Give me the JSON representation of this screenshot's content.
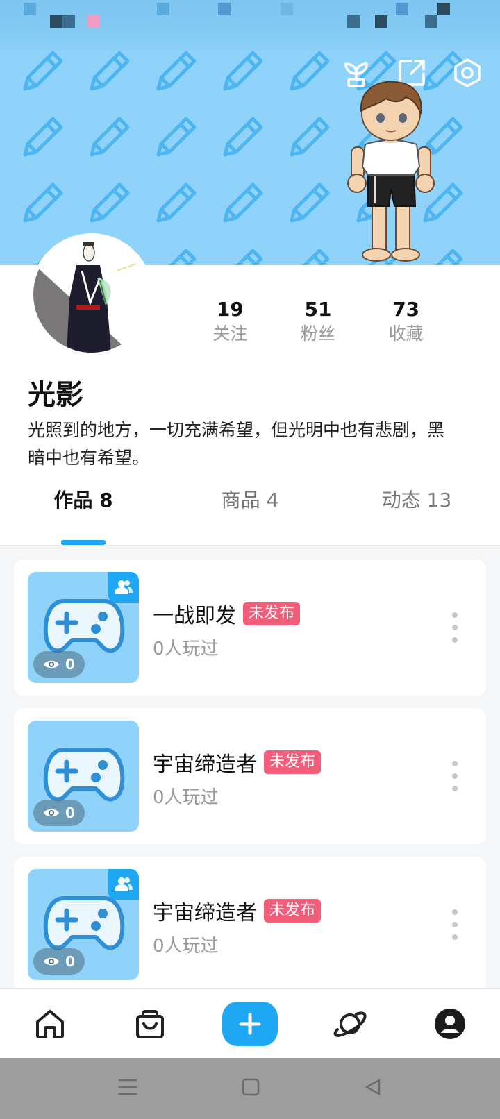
{
  "banner": {
    "icons": [
      "sprout-icon",
      "share-icon",
      "settings-icon"
    ],
    "colors": {
      "background": "#8fd3fb",
      "pencil": "#4db5f1"
    }
  },
  "profile": {
    "stats": [
      {
        "value": "19",
        "label": "关注"
      },
      {
        "value": "51",
        "label": "粉丝"
      },
      {
        "value": "73",
        "label": "收藏"
      }
    ],
    "username": "光影",
    "bio": "光照到的地方，一切充满希望，但光明中也有悲剧，黑暗中也有希望。"
  },
  "tabs": [
    {
      "label": "作品 8",
      "active": true
    },
    {
      "label": "商品 4",
      "active": false
    },
    {
      "label": "动态 13",
      "active": false
    }
  ],
  "works": [
    {
      "title": "一战即发",
      "status": "未发布",
      "plays": "0人玩过",
      "views": "0",
      "collab": true
    },
    {
      "title": "宇宙缔造者",
      "status": "未发布",
      "plays": "0人玩过",
      "views": "0",
      "collab": false
    },
    {
      "title": "宇宙缔造者",
      "status": "未发布",
      "plays": "0人玩过",
      "views": "0",
      "collab": true
    }
  ],
  "bottom_nav": {
    "items": [
      "home-icon",
      "shop-bag-icon",
      "create-plus-icon",
      "planet-icon",
      "profile-icon"
    ],
    "accent": "#1ea8f3"
  },
  "system_nav": [
    "menu-icon",
    "square-home-icon",
    "back-triangle-icon"
  ]
}
